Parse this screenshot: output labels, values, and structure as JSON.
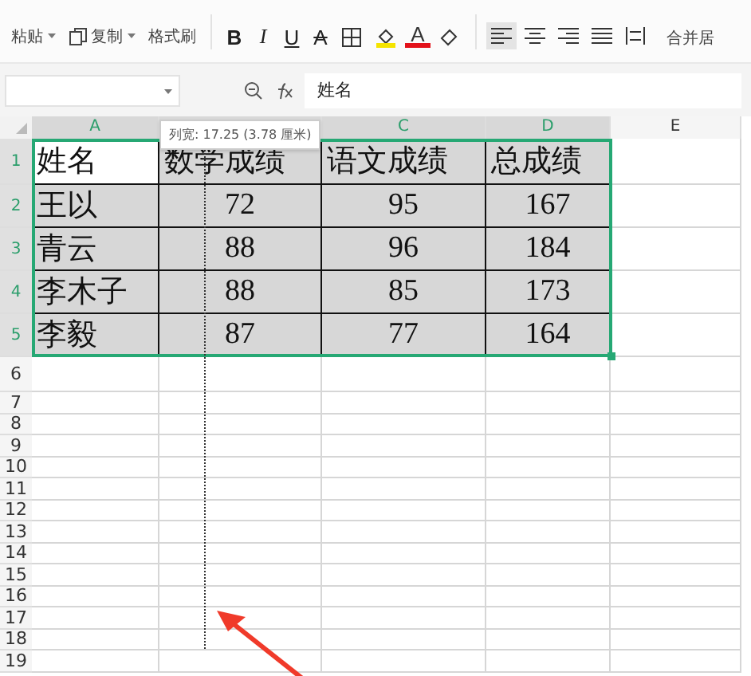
{
  "toolbar": {
    "clipboard": [
      {
        "kind": "paste",
        "label": "粘贴",
        "dropdown": true
      },
      {
        "kind": "copy",
        "label": "复制",
        "dropdown": true
      },
      {
        "kind": "painter",
        "label": "格式刷",
        "dropdown": false
      }
    ],
    "style_buttons": [
      {
        "kind": "bold",
        "label": "B"
      },
      {
        "kind": "italic",
        "label": "I"
      },
      {
        "kind": "underline",
        "label": "U"
      },
      {
        "kind": "strike",
        "label": "A"
      },
      {
        "kind": "borders"
      },
      {
        "kind": "fill"
      },
      {
        "kind": "font-color",
        "label": "A"
      },
      {
        "kind": "eraser"
      }
    ],
    "align_buttons": [
      {
        "kind": "left",
        "selected": true
      },
      {
        "kind": "center",
        "selected": false
      },
      {
        "kind": "right",
        "selected": false
      },
      {
        "kind": "justify",
        "selected": false
      },
      {
        "kind": "distributed",
        "selected": false
      }
    ],
    "merge_label": "合并居"
  },
  "formula_bar": {
    "value": "姓名"
  },
  "columns": [
    {
      "label": "A",
      "selected": true
    },
    {
      "selected": true
    },
    {
      "label": "C",
      "selected": true
    },
    {
      "label": "D",
      "selected": true
    },
    {
      "label": "E",
      "selected": false
    }
  ],
  "tooltip": "列宽: 17.25 (3.78 厘米)",
  "rows": [
    {
      "number": "1",
      "selected": true,
      "cells": [
        {
          "text": "姓名",
          "shaded": false
        },
        {
          "text": "数学成绩",
          "shaded": true
        },
        {
          "text": "语文成绩",
          "shaded": true
        },
        {
          "text": "总成绩",
          "shaded": true
        }
      ]
    },
    {
      "number": "2",
      "selected": true,
      "cells": [
        {
          "text": "王以",
          "shaded": true
        },
        {
          "text": "72",
          "shaded": true
        },
        {
          "text": "95",
          "shaded": true
        },
        {
          "text": "167",
          "shaded": true
        }
      ]
    },
    {
      "number": "3",
      "selected": true,
      "cells": [
        {
          "text": "青云",
          "shaded": true
        },
        {
          "text": "88",
          "shaded": true
        },
        {
          "text": "96",
          "shaded": true
        },
        {
          "text": "184",
          "shaded": true
        }
      ]
    },
    {
      "number": "4",
      "selected": true,
      "cells": [
        {
          "text": "李木子",
          "shaded": true
        },
        {
          "text": "88",
          "shaded": true
        },
        {
          "text": "85",
          "shaded": true
        },
        {
          "text": "173",
          "shaded": true
        }
      ]
    },
    {
      "number": "5",
      "selected": true,
      "cells": [
        {
          "text": "李毅",
          "shaded": true
        },
        {
          "text": "87",
          "shaded": true
        },
        {
          "text": "77",
          "shaded": true
        },
        {
          "text": "164",
          "shaded": true
        }
      ]
    },
    {
      "number": "6",
      "selected": false,
      "cells": []
    },
    {
      "number": "7",
      "selected": false,
      "cells": []
    },
    {
      "number": "8",
      "selected": false,
      "cells": []
    },
    {
      "number": "9",
      "selected": false,
      "cells": []
    },
    {
      "number": "10",
      "selected": false,
      "cells": []
    },
    {
      "number": "11",
      "selected": false,
      "cells": []
    },
    {
      "number": "12",
      "selected": false,
      "cells": []
    },
    {
      "number": "13",
      "selected": false,
      "cells": []
    },
    {
      "number": "14",
      "selected": false,
      "cells": []
    },
    {
      "number": "15",
      "selected": false,
      "cells": []
    },
    {
      "number": "16",
      "selected": false,
      "cells": []
    },
    {
      "number": "17",
      "selected": false,
      "cells": []
    },
    {
      "number": "18",
      "selected": false,
      "cells": []
    },
    {
      "number": "19",
      "selected": false,
      "cells": []
    }
  ]
}
